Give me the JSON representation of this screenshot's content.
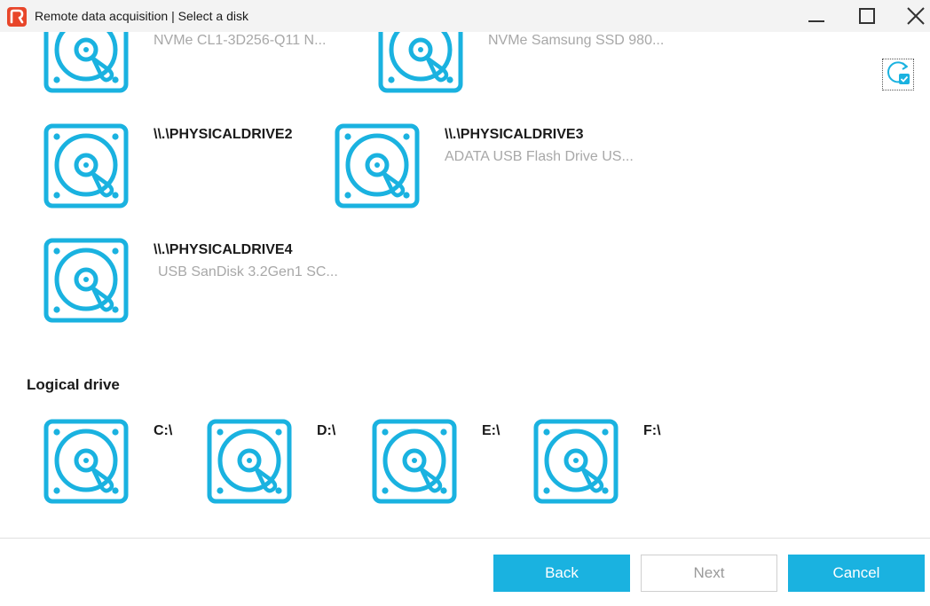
{
  "window": {
    "title": "Remote data acquisition | Select a disk",
    "logo_icon": "app-logo-icon",
    "controls": [
      "minimize-icon",
      "maximize-icon",
      "close-icon"
    ]
  },
  "accent_color": "#1ab2e0",
  "physical_disks": [
    {
      "name": "",
      "description": "NVMe CL1-3D256-Q11 N..."
    },
    {
      "name": "",
      "description": "NVMe Samsung SSD 980..."
    },
    {
      "name": "\\\\.\\PHYSICALDRIVE2",
      "description": ""
    },
    {
      "name": "\\\\.\\PHYSICALDRIVE3",
      "description": "ADATA USB Flash Drive US..."
    },
    {
      "name": "\\\\.\\PHYSICALDRIVE4",
      "description": "USB  SanDisk 3.2Gen1 SC..."
    }
  ],
  "logical_section": {
    "heading": "Logical drive",
    "drives": [
      {
        "name": "C:\\"
      },
      {
        "name": "D:\\"
      },
      {
        "name": "E:\\"
      },
      {
        "name": "F:\\"
      }
    ]
  },
  "refresh_icon": "refresh-check-icon",
  "buttons": {
    "back": "Back",
    "next": "Next",
    "cancel": "Cancel"
  }
}
